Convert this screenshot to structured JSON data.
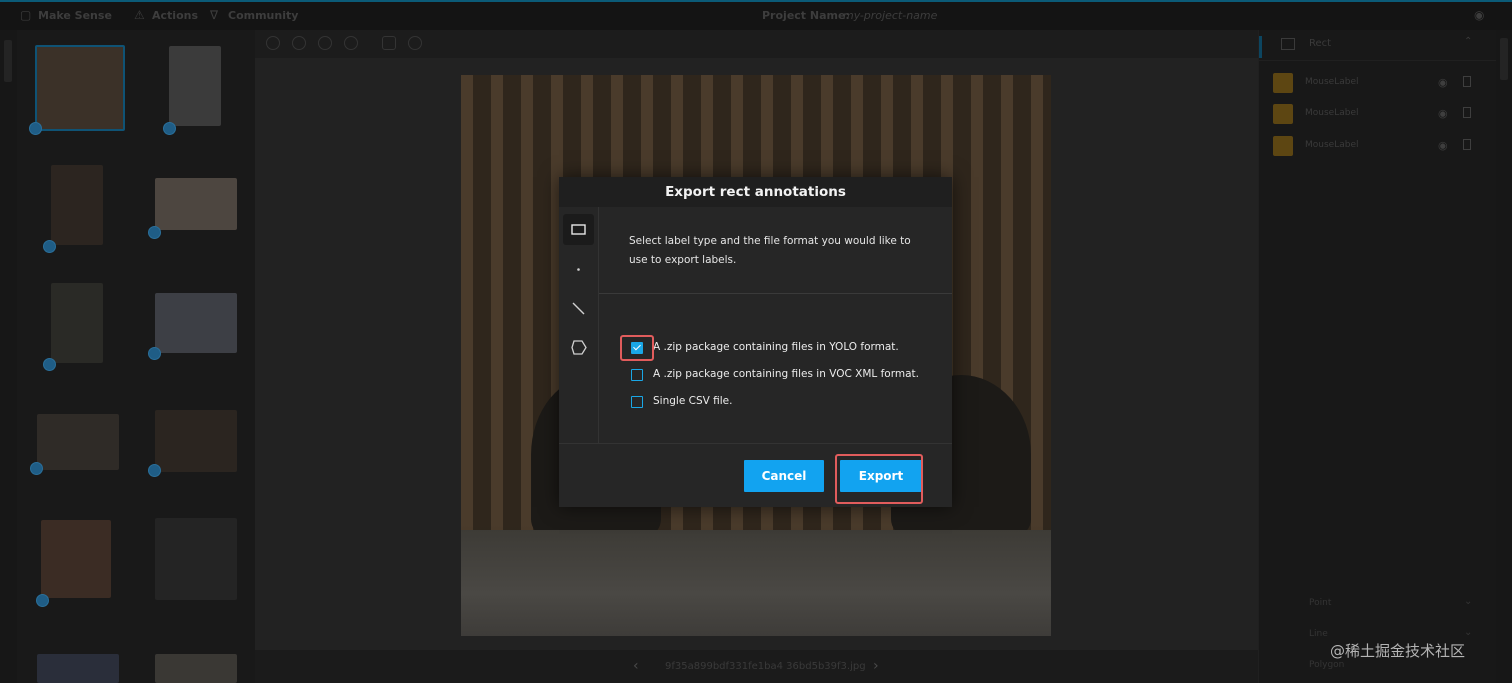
{
  "topbar": {
    "app_name": "Make Sense",
    "menu_actions": "Actions",
    "menu_community": "Community",
    "project_label": "Project Name:",
    "project_value": "my-project-name"
  },
  "editor": {
    "file_name": "9f35a899bdf331fe1ba4 36bd5b39f3.jpg"
  },
  "right_panel": {
    "header": "Rect",
    "labels": [
      {
        "name": "MouseLabel",
        "color": "#c98a12"
      },
      {
        "name": "MouseLabel",
        "color": "#c98a12"
      },
      {
        "name": "MouseLabel",
        "color": "#c98a12"
      }
    ],
    "sections": [
      "Point",
      "Line",
      "Polygon"
    ]
  },
  "modal": {
    "title": "Export rect annotations",
    "description": "Select label type and the file format you would like to use to export labels.",
    "options": [
      {
        "label": "A .zip package containing files in YOLO format.",
        "checked": true
      },
      {
        "label": "A .zip package containing files in VOC XML format.",
        "checked": false
      },
      {
        "label": "Single CSV file.",
        "checked": false
      }
    ],
    "cancel_label": "Cancel",
    "export_label": "Export"
  },
  "watermark": "@稀土掘金技术社区",
  "colors": {
    "accent": "#12a3f0",
    "highlight": "#e15c5c",
    "label_swatch": "#c98a12"
  }
}
